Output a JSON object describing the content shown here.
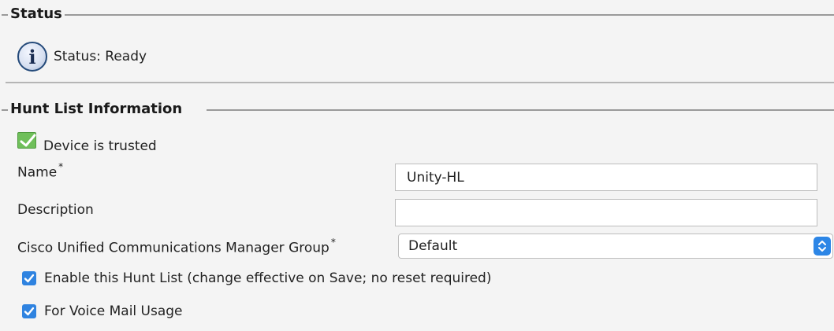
{
  "status_section": {
    "legend": "Status",
    "icon": "info-icon",
    "status_text": "Status: Ready"
  },
  "hunt_list_section": {
    "legend": "Hunt List Information",
    "trusted": {
      "icon": "checkmark-icon",
      "label": "Device is trusted"
    },
    "fields": {
      "name": {
        "label": "Name",
        "required": "*",
        "value": "Unity-HL"
      },
      "description": {
        "label": "Description",
        "value": ""
      },
      "cucm_group": {
        "label": "Cisco Unified Communications Manager Group",
        "required": "*",
        "selected": "Default"
      }
    },
    "checkboxes": {
      "enable": {
        "label": "Enable this Hunt List (change effective on Save; no reset required)",
        "checked": true
      },
      "voicemail": {
        "label": "For Voice Mail Usage",
        "checked": true
      }
    }
  },
  "colors": {
    "accent": "#2f83e0",
    "trusted_green": "#6fbf5a",
    "info_icon_blue": "#244a7a"
  }
}
